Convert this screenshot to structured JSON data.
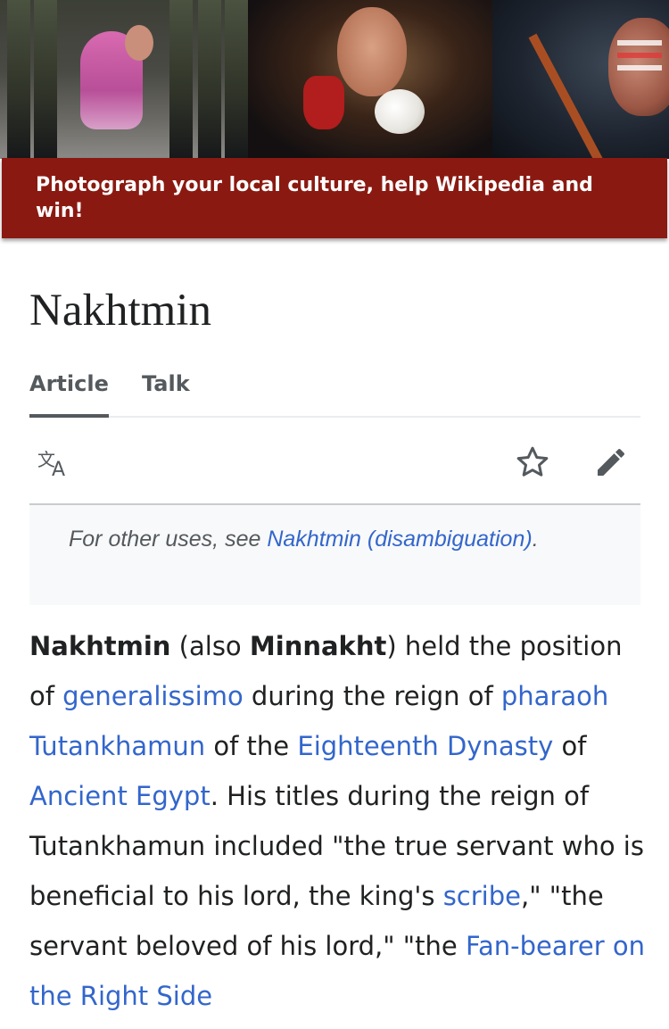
{
  "banner": {
    "text": "Photograph your local culture, help Wikipedia and win!"
  },
  "page": {
    "title": "Nakhtmin"
  },
  "tabs": [
    {
      "label": "Article",
      "selected": true
    },
    {
      "label": "Talk",
      "selected": false
    }
  ],
  "toolbar": {
    "language_icon": "translate-icon",
    "watch_icon": "star-icon",
    "edit_icon": "pencil-icon"
  },
  "hatnote": {
    "prefix": "For other uses, see ",
    "link": "Nakhtmin (disambiguation)",
    "suffix": "."
  },
  "article": {
    "p1": "Nakhtmin",
    "p2": " (also ",
    "p3": "Minnakht",
    "p4": ") held the position of ",
    "l1": "generalissimo",
    "p5": " during the reign of ",
    "l2": "pharaoh Tutankhamun",
    "p6": " of the ",
    "l3": "Eighteenth Dynasty",
    "p7": " of ",
    "l4": "Ancient Egypt",
    "p8": ". His titles during the reign of Tutankhamun included \"the true servant who is beneficial to his lord, the king's ",
    "l5": "scribe",
    "p9": ",\" \"the servant beloved of his lord,\" \"the ",
    "l6": "Fan-bearer on the Right Side"
  },
  "colors": {
    "banner_bar": "#8a1a11",
    "link": "#3366cc",
    "text": "#202122",
    "muted": "#54595d"
  }
}
